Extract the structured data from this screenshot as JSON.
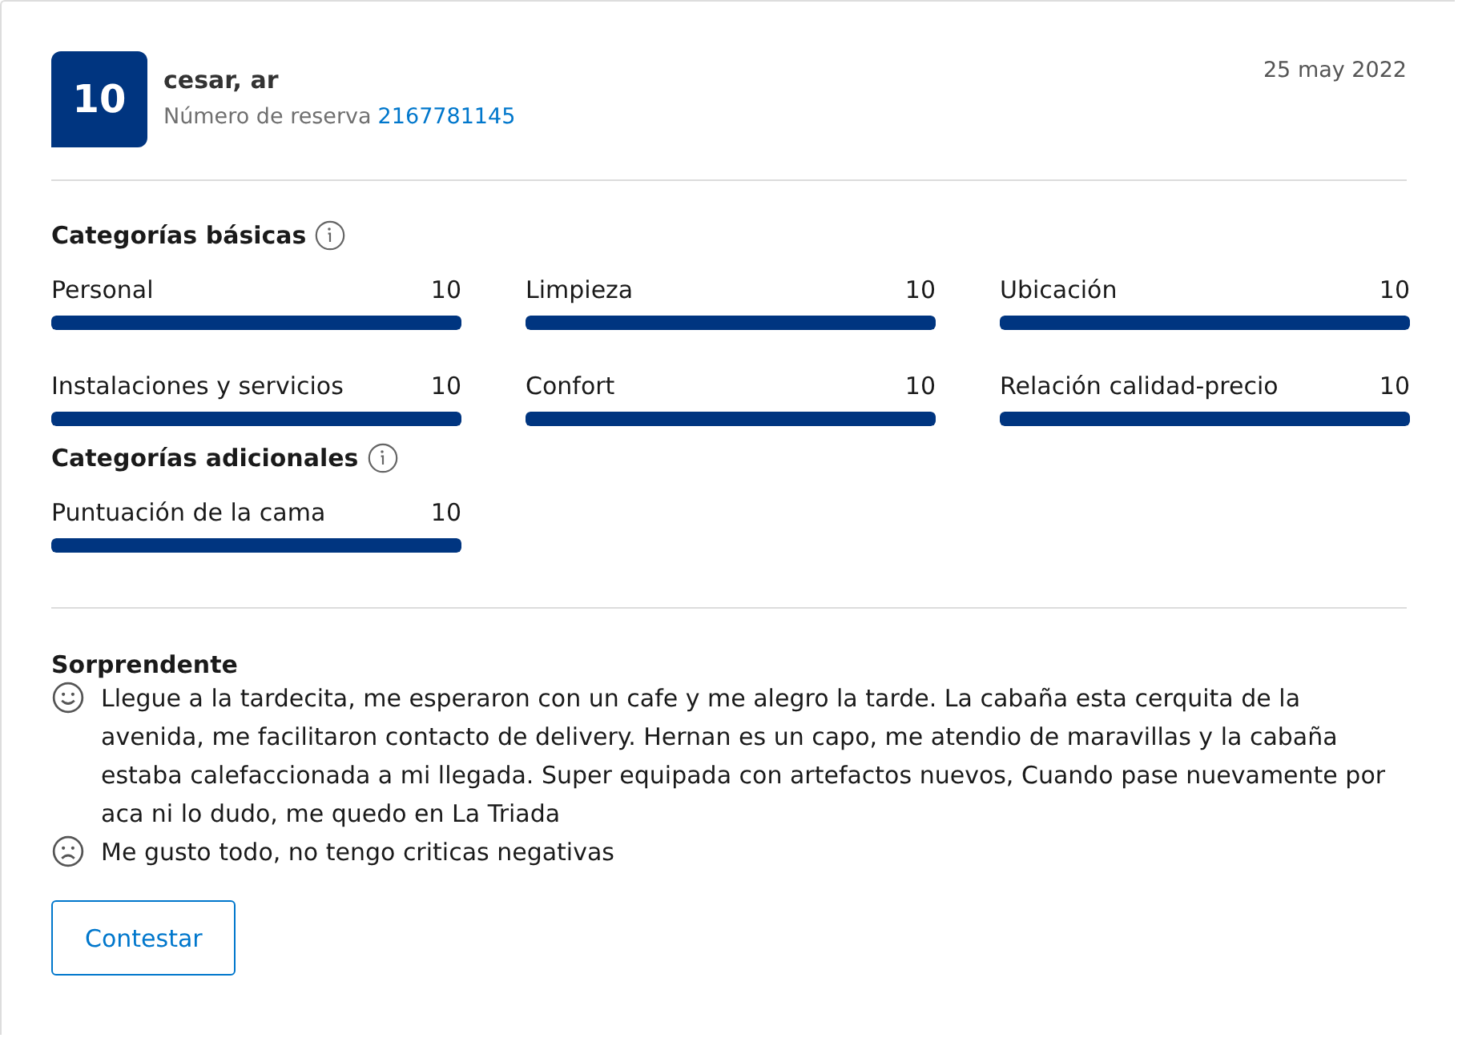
{
  "review": {
    "score": "10",
    "reviewer": "cesar, ar",
    "reservation_label": "Número de reserva",
    "reservation_number": "2167781145",
    "date": "25 may 2022"
  },
  "sections": [
    {
      "title": "Categorías básicas",
      "categories": [
        {
          "name": "Personal",
          "score": "10",
          "level": 1
        },
        {
          "name": "Limpieza",
          "score": "10",
          "level": 1
        },
        {
          "name": "Ubicación",
          "score": "10",
          "level": 1
        },
        {
          "name": "Instalaciones y servicios",
          "score": "10",
          "level": 1
        },
        {
          "name": "Confort",
          "score": "10",
          "level": 1
        },
        {
          "name": "Relación calidad-precio",
          "score": "10",
          "level": 1
        }
      ]
    },
    {
      "title": "Categorías adicionales",
      "categories": [
        {
          "name": "Puntuación de la cama",
          "score": "10",
          "level": 1
        }
      ]
    }
  ],
  "comment_title": "Sorprendente",
  "comments": [
    {
      "kind": "positive",
      "text": "Llegue a la tardecita, me esperaron con un cafe y me alegro la tarde. La cabaña esta cerquita de la avenida, me facilitaron contacto de delivery. Hernan es un capo, me atendio de maravillas y la cabaña estaba calefaccionada a mi llegada. Super equipada con artefactos nuevos, Cuando pase nuevamente por aca ni lo dudo, me quedo en La Triada"
    },
    {
      "kind": "negative",
      "text": "Me gusto todo, no tengo criticas negativas"
    }
  ],
  "reply_button": "Contestar"
}
